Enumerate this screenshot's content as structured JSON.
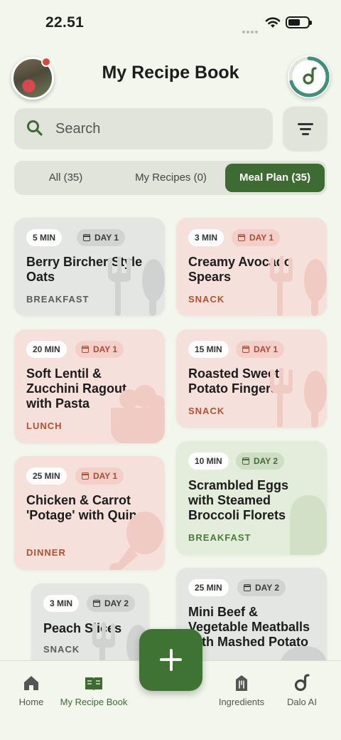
{
  "status_bar": {
    "time": "22.51"
  },
  "header": {
    "title": "My Recipe Book"
  },
  "search": {
    "placeholder": "Search"
  },
  "tabs": [
    {
      "label": "All (35)"
    },
    {
      "label": "My Recipes (0)"
    },
    {
      "label": "Meal Plan (35)",
      "active": true
    }
  ],
  "recipes": [
    {
      "time": "5 MIN",
      "day": "DAY 1",
      "title": "Berry Bircher Style Oats",
      "meal": "BREAKFAST",
      "theme": "gray"
    },
    {
      "time": "3 MIN",
      "day": "DAY 1",
      "title": "Creamy Avocado Spears",
      "meal": "SNACK",
      "theme": "pink"
    },
    {
      "time": "20 MIN",
      "day": "DAY 1",
      "title": "Soft Lentil & Zucchini Ragout with Pasta",
      "meal": "LUNCH",
      "theme": "pink"
    },
    {
      "time": "15 MIN",
      "day": "DAY 1",
      "title": "Roasted Sweet Potato Fingers",
      "meal": "SNACK",
      "theme": "pink"
    },
    {
      "time": "10 MIN",
      "day": "DAY 2",
      "title": "Scrambled Eggs with Steamed Broccoli Florets",
      "meal": "BREAKFAST",
      "theme": "green"
    },
    {
      "time": "25 MIN",
      "day": "DAY 1",
      "title": "Chicken & Carrot 'Potage' with Quinoa",
      "meal": "DINNER",
      "theme": "pink"
    },
    {
      "time": "25 MIN",
      "day": "DAY 2",
      "title": "Mini Beef & Vegetable Meatballs with Mashed Potato",
      "meal": "",
      "theme": "gray"
    },
    {
      "time": "3 MIN",
      "day": "DAY 2",
      "title": "Peach Slices",
      "meal": "SNACK",
      "theme": "gray"
    }
  ],
  "bottom_nav": [
    {
      "label": "Home",
      "icon": "home-icon"
    },
    {
      "label": "My Recipe Book",
      "icon": "book-icon",
      "active": true
    },
    {
      "label": "Ingredients",
      "icon": "ingredients-icon"
    },
    {
      "label": "Dalo AI",
      "icon": "dalo-icon"
    }
  ],
  "colors": {
    "accent": "#3e6b32",
    "background": "#f2f6ec",
    "notification": "#e0453c"
  }
}
